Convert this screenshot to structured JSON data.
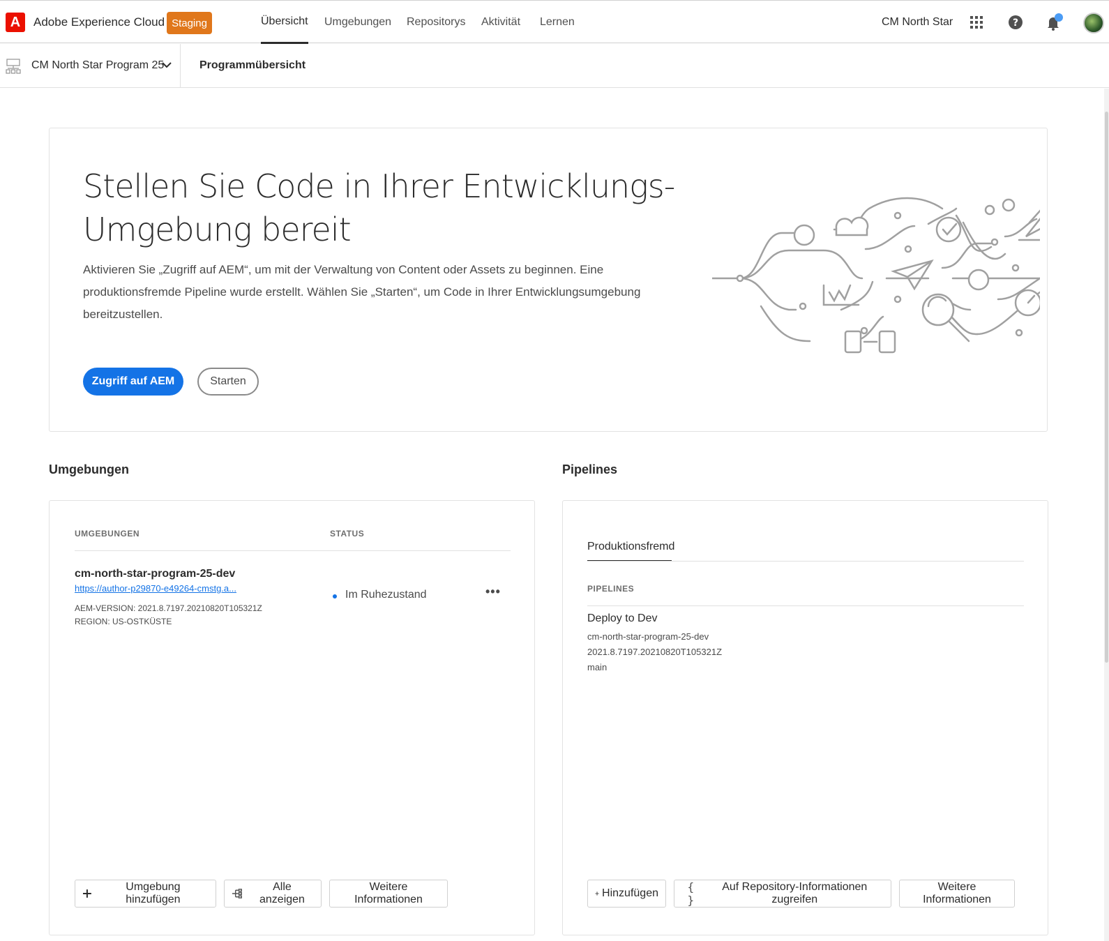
{
  "header": {
    "logo_letter": "A",
    "brand": "Adobe Experience Cloud",
    "badge": "Staging",
    "nav": [
      {
        "label": "Übersicht",
        "active": true
      },
      {
        "label": "Umgebungen"
      },
      {
        "label": "Repositorys"
      },
      {
        "label": "Aktivität"
      },
      {
        "label": "Lernen"
      }
    ],
    "org": "CM North Star",
    "icons": [
      "apps-grid-icon",
      "help-icon",
      "bell-icon",
      "avatar"
    ]
  },
  "subbar": {
    "program": "CM North Star Program 25",
    "breadcrumb": "Programmübersicht"
  },
  "hero": {
    "title_line1": "Stellen Sie Code in Ihrer Entwicklungs-",
    "title_line2": "Umgebung bereit",
    "description": "Aktivieren Sie „Zugriff auf AEM“, um mit der Verwaltung von Content oder Assets zu beginnen. Eine produktionsfremde Pipeline wurde erstellt. Wählen Sie „Starten“, um Code in Ihrer Entwicklungsumgebung bereitzustellen.",
    "primary_button": "Zugriff auf AEM",
    "secondary_button": "Starten"
  },
  "environments": {
    "section_title": "Umgebungen",
    "col_env": "UMGEBUNGEN",
    "col_status": "STATUS",
    "item": {
      "name": "cm-north-star-program-25-dev",
      "link": "https://author-p29870-e49264-cmstg.a...",
      "version": "AEM-VERSION: 2021.8.7197.20210820T105321Z",
      "region": "REGION: US-OSTKÜSTE",
      "status": "Im Ruhezustand",
      "more": "•••"
    },
    "buttons": {
      "add": "Umgebung hinzufügen",
      "show_all": "Alle anzeigen",
      "more_info": "Weitere Informationen"
    }
  },
  "pipelines": {
    "section_title": "Pipelines",
    "tab": "Produktionsfremd",
    "col_head": "PIPELINES",
    "item": {
      "name": "Deploy to Dev",
      "env": "cm-north-star-program-25-dev",
      "version": "2021.8.7197.20210820T105321Z",
      "branch": "main"
    },
    "buttons": {
      "add": "Hinzufügen",
      "repo_info": "Auf Repository-Informationen zugreifen",
      "more_info": "Weitere Informationen"
    }
  },
  "colors": {
    "accent": "#1473e6",
    "staging": "#e0771b",
    "adobe_red": "#eb1000",
    "notification": "#4b9cf5"
  }
}
